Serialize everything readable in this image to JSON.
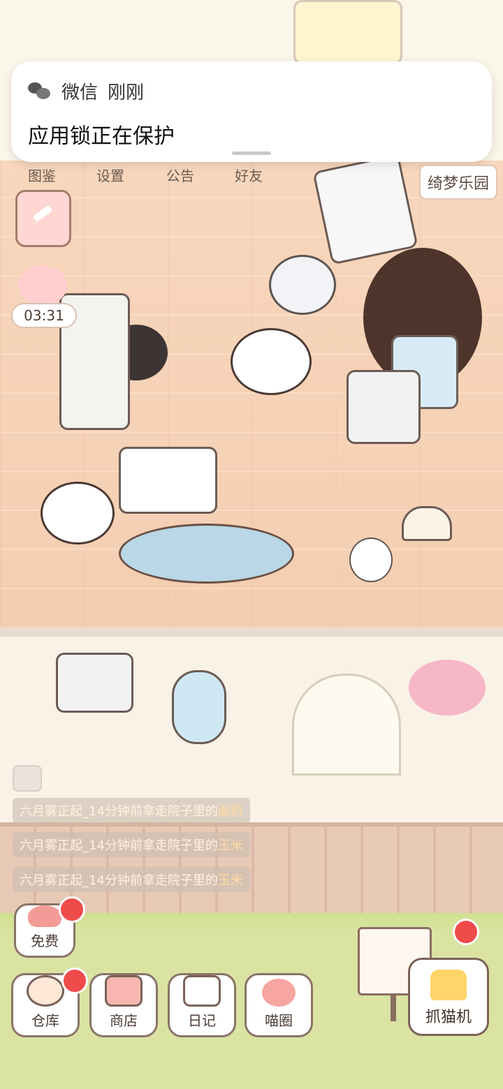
{
  "notification": {
    "app": "微信",
    "time": "刚刚",
    "title": "应用锁正在保护"
  },
  "top_menu": {
    "items": [
      "图鉴",
      "设置",
      "公告",
      "好友"
    ],
    "park": "绮梦乐园"
  },
  "timer": "03:31",
  "messages": [
    {
      "prefix": "六月雾正起_14分钟前拿走院子里的",
      "item": "面粉"
    },
    {
      "prefix": "六月雾正起_14分钟前拿走院子里的",
      "item": "玉米"
    },
    {
      "prefix": "六月雾正起_14分钟前拿走院子里的",
      "item": "玉米"
    }
  ],
  "bottom_buttons": {
    "free": "免费",
    "warehouse": "仓库",
    "shop": "商店",
    "diary": "日记",
    "meow_circle": "喵圈",
    "claw_machine": "抓猫机"
  },
  "colors": {
    "notification_dot": "#ef4b4b",
    "floor": "#f4ceb1",
    "yard": "#dbe3a3"
  }
}
